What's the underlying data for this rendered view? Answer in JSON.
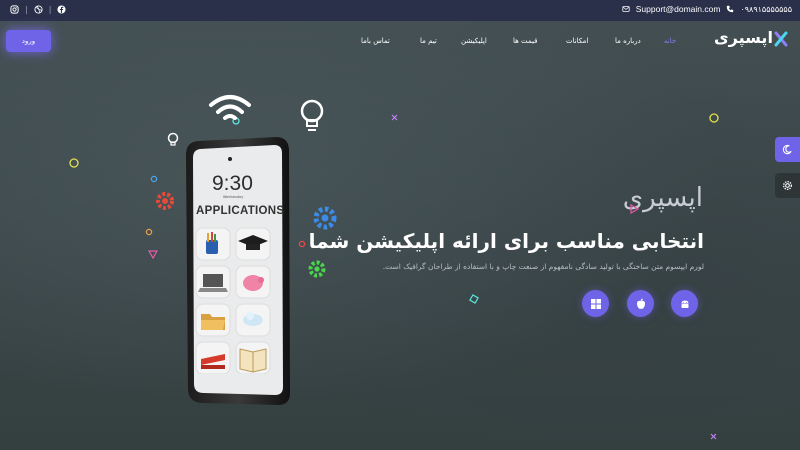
{
  "topbar": {
    "email": "Support@domain.com",
    "phone": "۰۹۸۹۱۵۵۵۵۵۵۵"
  },
  "nav": {
    "login_label": "ورود",
    "items": [
      {
        "label": "خانه",
        "active": true
      },
      {
        "label": "درباره ما"
      },
      {
        "label": "امکانات"
      },
      {
        "label": "قیمت ها"
      },
      {
        "label": "اپلیکیشن"
      },
      {
        "label": "تیم ما"
      },
      {
        "label": "تماس باما"
      }
    ],
    "logo_text": "اپسپری"
  },
  "hero": {
    "brand": "اپسپری",
    "title": "انتخابی مناسب برای ارائه اپلیکیشن شما",
    "description": "لورم ایپسوم متن ساختگی با تولید سادگی نامفهوم از صنعت چاپ و با استفاده از طراحان گرافیک است.",
    "platforms": [
      "windows-icon",
      "apple-icon",
      "android-icon"
    ]
  },
  "phone_screen": {
    "time": "9:30",
    "date": "Wednesday",
    "title": "APPLICATIONS"
  },
  "colors": {
    "accent": "#6f63e8",
    "topbar_bg": "#2a2f4a",
    "active_nav": "#8c7ff7"
  }
}
